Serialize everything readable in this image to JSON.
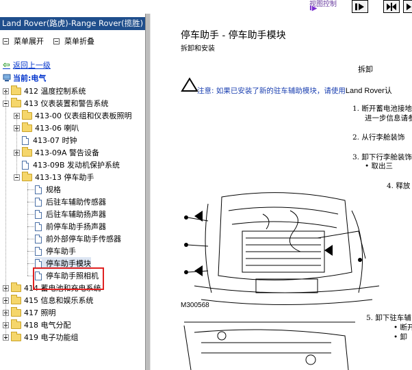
{
  "toolbar": {
    "hint": "视图控制",
    "purple_icon": "I▶",
    "buttons": [
      {
        "name": "next-page-button",
        "icon": "arrow-right-icon"
      },
      {
        "name": "split-view-button",
        "icon": "split-arrows-icon"
      },
      {
        "name": "last-page-button",
        "icon": "arrow-right-end-icon"
      }
    ]
  },
  "left": {
    "title": "Land Rover(路虎)-Range Rover(揽胜)",
    "expand_menu": "菜单展开",
    "collapse_menu": "菜单折叠",
    "back": "返回上一级",
    "current": "当前:电气",
    "tree": [
      {
        "label": "412 温度控制系统",
        "type": "folder",
        "expander": "plus",
        "level": 0
      },
      {
        "label": "413 仪表装置和警告系统",
        "type": "folder",
        "expander": "minus",
        "level": 0
      },
      {
        "label": "413-00 仪表组和仪表板照明",
        "type": "folder",
        "expander": "plus",
        "level": 1
      },
      {
        "label": "413-06 喇叭",
        "type": "folder",
        "expander": "plus",
        "level": 1
      },
      {
        "label": "413-07 时钟",
        "type": "doc",
        "expander": "none",
        "level": 1
      },
      {
        "label": "413-09A 警告设备",
        "type": "folder",
        "expander": "plus",
        "level": 1
      },
      {
        "label": "413-09B 发动机保护系统",
        "type": "doc",
        "expander": "none",
        "level": 1
      },
      {
        "label": "413-13 停车助手",
        "type": "folder",
        "expander": "minus",
        "level": 1
      },
      {
        "label": "规格",
        "type": "doc",
        "expander": "none",
        "level": 2
      },
      {
        "label": "后驻车辅助传感器",
        "type": "doc",
        "expander": "none",
        "level": 2
      },
      {
        "label": "后驻车辅助扬声器",
        "type": "doc",
        "expander": "none",
        "level": 2
      },
      {
        "label": "前停车助手扬声器",
        "type": "doc",
        "expander": "none",
        "level": 2
      },
      {
        "label": "前外部停车助手传感器",
        "type": "doc",
        "expander": "none",
        "level": 2
      },
      {
        "label": "停车助手",
        "type": "doc",
        "expander": "none",
        "level": 2
      },
      {
        "label": "停车助手模块",
        "type": "doc",
        "expander": "none",
        "level": 2,
        "selected": true
      },
      {
        "label": "停车助手照相机",
        "type": "doc",
        "expander": "none",
        "level": 2
      },
      {
        "label": "414 蓄电池和充电系统",
        "type": "folder",
        "expander": "plus",
        "level": 0
      },
      {
        "label": "415 信息和娱乐系统",
        "type": "folder",
        "expander": "plus",
        "level": 0
      },
      {
        "label": "417 照明",
        "type": "folder",
        "expander": "plus",
        "level": 0
      },
      {
        "label": "418 电气分配",
        "type": "folder",
        "expander": "plus",
        "level": 0
      },
      {
        "label": "419 电子功能组",
        "type": "folder",
        "expander": "plus",
        "level": 0
      }
    ]
  },
  "doc": {
    "title": "停车助手 - 停车助手模块",
    "subtitle": "拆卸和安装",
    "section": "拆卸",
    "note_label": "注意:",
    "note_text": "如果已安装了新的驻车辅助模块，请使用",
    "note_brand": "Land Rover认",
    "steps": [
      {
        "num": "1.",
        "text": "断开蓄电池接地"
      },
      {
        "num": "",
        "text": "进一步信息请参"
      },
      {
        "num": "2.",
        "text": "从行李舱装饰"
      },
      {
        "num": "3.",
        "text": "卸下行李舱装饰"
      },
      {
        "num": "•",
        "text": "取出三"
      },
      {
        "num": "4.",
        "text": "释放"
      },
      {
        "num": "5.",
        "text": "卸下驻车辅"
      },
      {
        "num": "•",
        "text": "断开"
      },
      {
        "num": "•",
        "text": "卸"
      }
    ],
    "figure_label": "M300568"
  },
  "colors": {
    "title_bar": "#1f4e8c",
    "link": "#0033cc",
    "note": "#1a3fb0",
    "highlight_box": "#e02020"
  }
}
